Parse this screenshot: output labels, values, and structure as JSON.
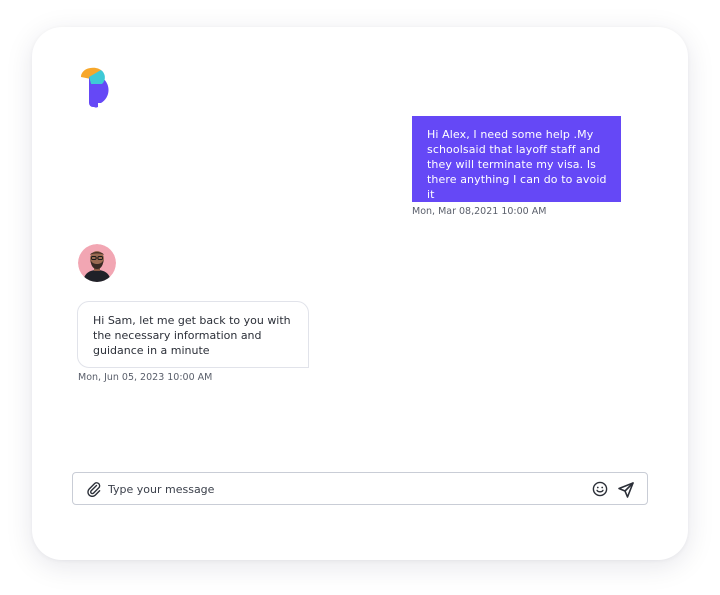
{
  "app": {
    "logo_icon": "brand-logo-icon"
  },
  "messages": [
    {
      "direction": "outgoing",
      "text": "Hi Alex, I need some help .My schoolsaid that layoff staff and they will terminate my visa. Is there anything I can do to avoid it",
      "timestamp": "Mon, Mar 08,2021 10:00 AM"
    },
    {
      "direction": "incoming",
      "avatar_icon": "agent-avatar",
      "text": "Hi Sam, let me get back to you with the necessary information and guidance in a minute",
      "timestamp": "Mon, Jun 05, 2023 10:00 AM"
    }
  ],
  "composer": {
    "placeholder": "Type your message",
    "value": "",
    "attach_icon": "paperclip-icon",
    "emoji_icon": "smiley-icon",
    "send_icon": "send-icon"
  },
  "colors": {
    "accent": "#6548f6",
    "logo_orange": "#f7a72b",
    "logo_teal": "#3ec9d6",
    "logo_purple": "#6548f6",
    "card_bg": "#ffffff",
    "border": "#c9cdd6"
  }
}
